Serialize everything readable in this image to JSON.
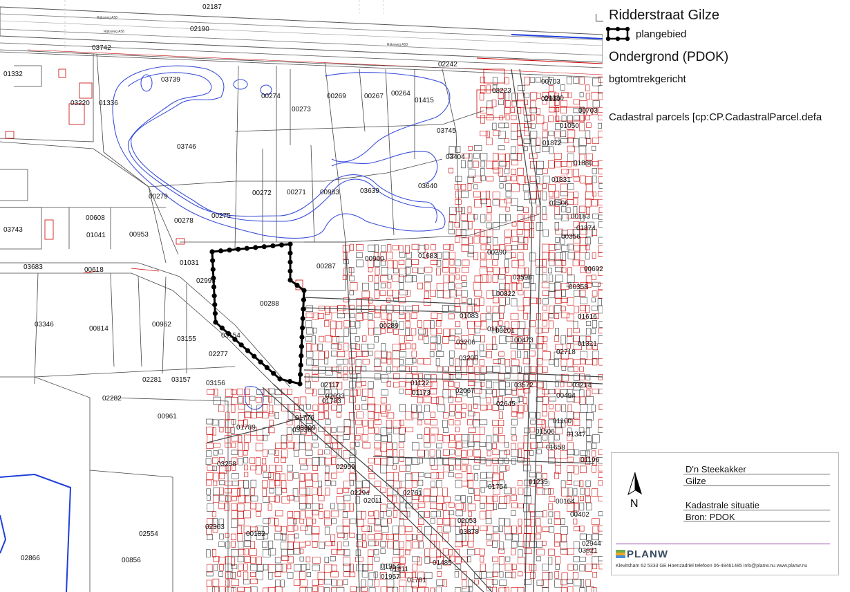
{
  "legend": {
    "title": "Ridderstraat Gilze",
    "plan_area_label": "plangebied",
    "layer_title": "Ondergrond (PDOK)",
    "layer_style": "bgtomtrekgericht",
    "cadastral_label": "Cadastral parcels [cp:CP.CadastralParcel.defa"
  },
  "title_block": {
    "project_name": "D'n Steekakker",
    "place": "Gilze",
    "drawing_title": "Kadastrale situatie",
    "source": "Bron: PDOK",
    "north_label": "N",
    "company": "PLANW",
    "contact": "Klevitsham 62 5333 GE Hoenzadriel telefoon 06-48461485 info@planw.nu www.planw.nu"
  },
  "colors": {
    "plan_boundary": "#000000",
    "cadastral_lines": "#cc0000",
    "bgt_lines": "#555555",
    "water_lines": "#3b4fd9",
    "brand_purple": "#8e3aa8"
  },
  "map": {
    "road_labels": [
      "Rijksweg A58",
      "Rijksweg A58",
      "Rijksweg A58"
    ],
    "parcels": [
      "02187",
      "02190",
      "03742",
      "01332",
      "03739",
      "00274",
      "00273",
      "00269",
      "00267",
      "00264",
      "01415",
      "02242",
      "03223",
      "00703",
      "01330",
      "03220",
      "01336",
      "03746",
      "03745",
      "03404",
      "03640",
      "03639",
      "00983",
      "00271",
      "00272",
      "00275",
      "00278",
      "00279",
      "03743",
      "00608",
      "01041",
      "00953",
      "01031",
      "00287",
      "00290",
      "02995",
      "00288",
      "00289",
      "03346",
      "00814",
      "00962",
      "03155",
      "03154",
      "02277",
      "02281",
      "03157",
      "03156",
      "02282",
      "00961",
      "02866",
      "00856",
      "02554",
      "02645",
      "03214",
      "00900",
      "01683",
      "01100",
      "03683",
      "00618",
      "00822",
      "01083",
      "03201",
      "01177",
      "03206",
      "03200",
      "01122",
      "01173",
      "02067",
      "01506",
      "01347",
      "01235",
      "00164",
      "00402",
      "02944",
      "03921",
      "01485",
      "02959",
      "01954",
      "02117",
      "01789",
      "03258",
      "00182",
      "02363",
      "02294",
      "02011",
      "02053",
      "03878",
      "01754",
      "02761",
      "01411",
      "01957",
      "01781",
      "01783",
      "01776",
      "03399",
      "02033",
      "02010",
      "01880",
      "00703",
      "01050",
      "01872",
      "01331",
      "02506",
      "00183",
      "01874",
      "00356",
      "00692",
      "00358",
      "01616",
      "01321",
      "02718",
      "03572",
      "00494",
      "01658",
      "01196",
      "03598",
      "00473",
      "03336",
      "03300",
      "02005"
    ]
  }
}
